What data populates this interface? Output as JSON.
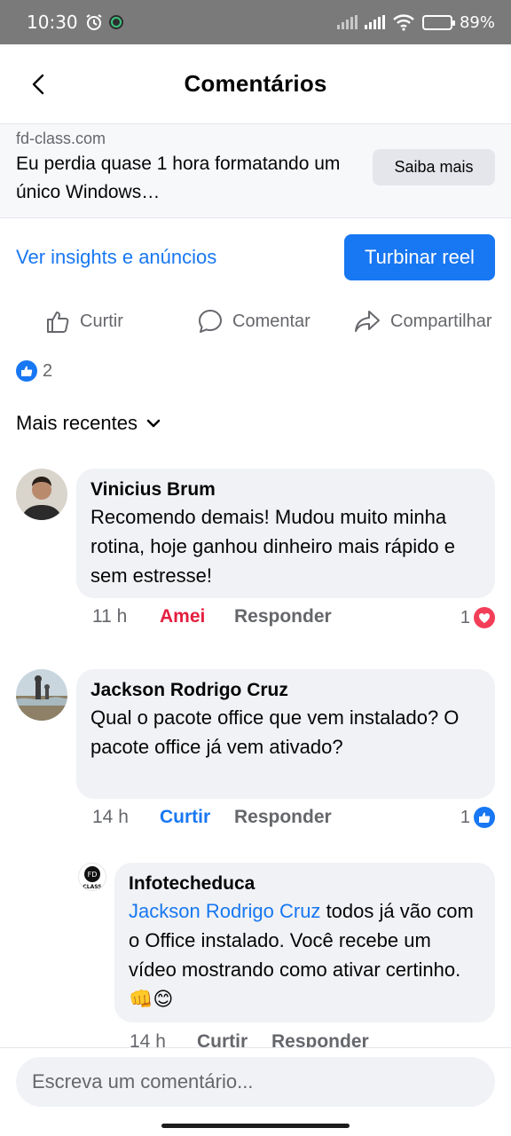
{
  "status_bar": {
    "time": "10:30",
    "battery": "89%"
  },
  "header": {
    "title": "Comentários"
  },
  "ad": {
    "domain": "fd-class.com",
    "headline": "Eu perdia quase 1 hora formatando um único Windows…",
    "cta": "Saiba mais"
  },
  "insights": {
    "link": "Ver insights e anúncios",
    "boost": "Turbinar reel"
  },
  "actions": {
    "like": "Curtir",
    "comment": "Comentar",
    "share": "Compartilhar"
  },
  "reactions": {
    "count": "2"
  },
  "sort": {
    "label": "Mais recentes"
  },
  "comments": [
    {
      "author": "Vinicius Brum",
      "text": "Recomendo demais! Mudou muito minha rotina, hoje ganhou dinheiro mais rápido e sem estresse!",
      "time": "11 h",
      "reaction": "Amei",
      "reply": "Responder",
      "reaction_count": "1",
      "reaction_icon": "heart-icon"
    },
    {
      "author": "Jackson Rodrigo Cruz",
      "text": "Qual o pacote office que vem instalado? O pacote office já vem ativado?",
      "time": "14 h",
      "reaction": "Curtir",
      "reply": "Responder",
      "reaction_count": "1",
      "reaction_icon": "like-icon"
    },
    {
      "author": "Infotecheduca",
      "mention": "Jackson Rodrigo Cruz",
      "text": "todos já vão com o Office instalado. Você recebe um vídeo mostrando como ativar certinho. 👊😊",
      "time": "14 h",
      "reaction": "Curtir",
      "reply": "Responder",
      "avatar_text": "CLASS"
    }
  ],
  "composer": {
    "placeholder": "Escreva um comentário..."
  },
  "colors": {
    "accent": "#1877f2",
    "love": "#f33e58",
    "bubble": "#f0f2f5",
    "muted": "#65676b"
  }
}
